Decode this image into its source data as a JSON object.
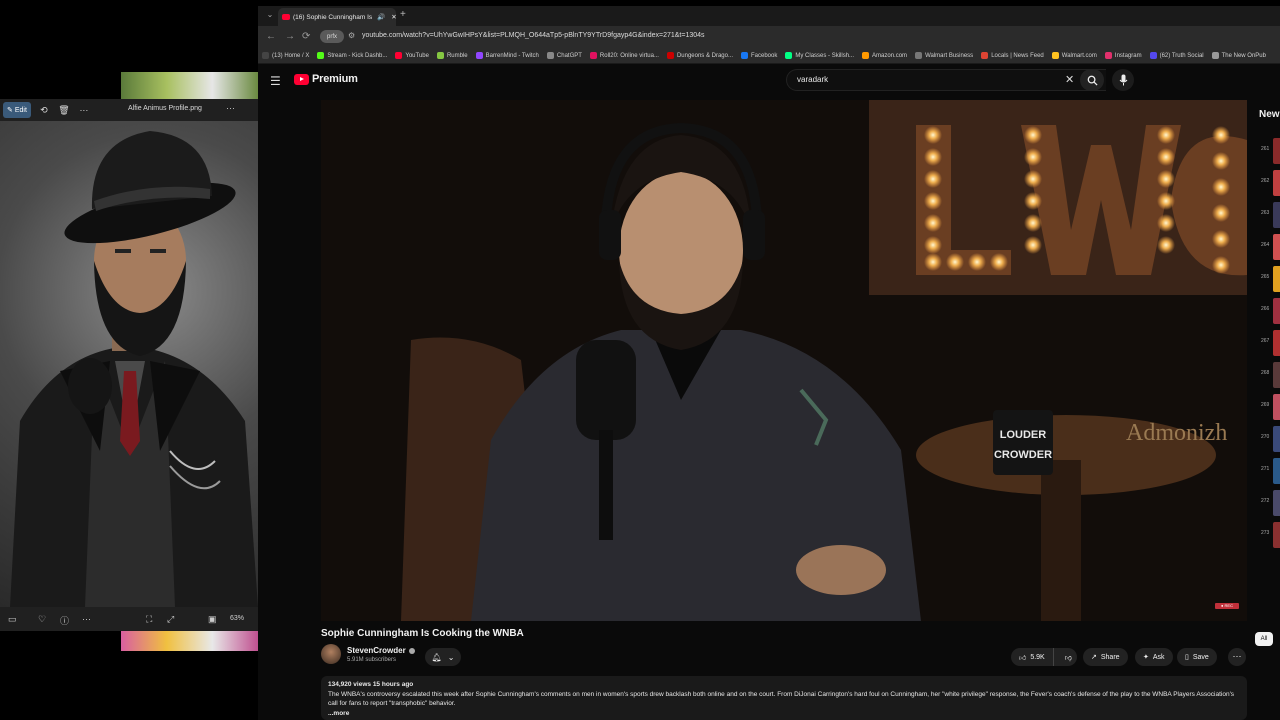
{
  "photos": {
    "edit_label": "Edit",
    "file_name": "Alfie Animus Profile.png",
    "zoom": "63%"
  },
  "browser": {
    "tab_title": "(16) Sophie Cunningham Is",
    "url_chip": "prfx",
    "url": "youtube.com/watch?v=UhYwGwIHPsY&list=PLMQH_O644aTp5-pBlnTY9YTrD9fgayp4G&index=271&t=1304s",
    "bookmarks": [
      {
        "label": "(13) Home / X",
        "color": "#444"
      },
      {
        "label": "Stream - Kick Dashb...",
        "color": "#53fc18"
      },
      {
        "label": "YouTube",
        "color": "#ff0033"
      },
      {
        "label": "Rumble",
        "color": "#85c742"
      },
      {
        "label": "BarrenMind - Twitch",
        "color": "#9146ff"
      },
      {
        "label": "ChatGPT",
        "color": "#888"
      },
      {
        "label": "Roll20: Online virtua...",
        "color": "#e0115f"
      },
      {
        "label": "Dungeons & Drago...",
        "color": "#c00"
      },
      {
        "label": "Facebook",
        "color": "#1877f2"
      },
      {
        "label": "My Classes - Skillsh...",
        "color": "#00ff84"
      },
      {
        "label": "Amazon.com",
        "color": "#ff9900"
      },
      {
        "label": "Walmart Business",
        "color": "#777"
      },
      {
        "label": "Locals | News Feed",
        "color": "#d43"
      },
      {
        "label": "Walmart.com",
        "color": "#ffc220"
      },
      {
        "label": "Instagram",
        "color": "#e1306c"
      },
      {
        "label": "(62) Truth Social",
        "color": "#5448ee"
      },
      {
        "label": "The New OnPub",
        "color": "#999"
      }
    ]
  },
  "youtube": {
    "logo_text": "Premium",
    "search_query": "varadark",
    "video_title": "Sophie Cunningham Is Cooking the WNBA",
    "channel_name": "StevenCrowder",
    "subscribers": "5.91M subscribers",
    "likes": "5.9K",
    "share_label": "Share",
    "ask_label": "Ask",
    "save_label": "Save",
    "description_meta": "134,920 views  15 hours ago",
    "description": "The WNBA's controversy escalated this week after Sophie Cunningham's comments on men in women's sports drew backlash both online and on the court. From DiJonai Carrington's hard foul on Cunningham, her \"white privilege\" response, the Fever's coach's defense of the play to the WNBA Players Association's call for fans to report \"transphobic\" behavior.",
    "description_more": "...more",
    "sidebar_heading": "New",
    "sidebar_filter": "All",
    "sidebar_numbers": [
      "261",
      "262",
      "263",
      "264",
      "265",
      "266",
      "267",
      "268",
      "269",
      "270",
      "271",
      "272",
      "273"
    ],
    "video_sign_text": "LWC",
    "mug_text": "LOUDER CROWDER",
    "sign_text": "Admonizh",
    "live_badge": "● REC"
  }
}
